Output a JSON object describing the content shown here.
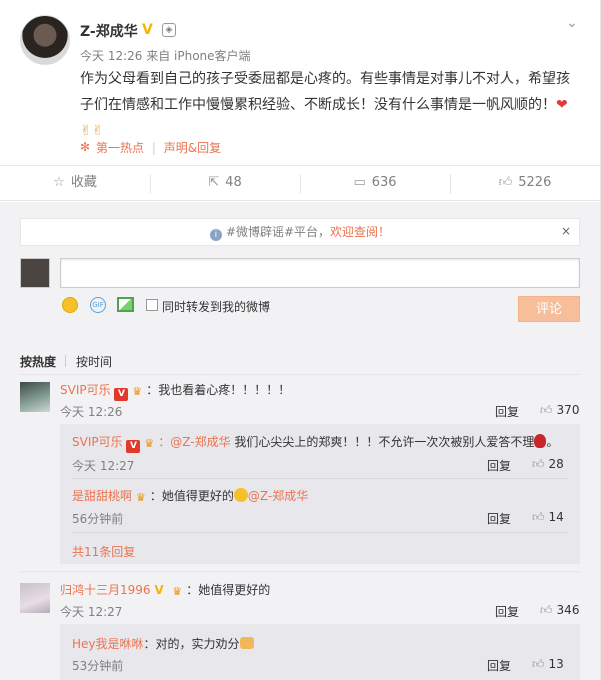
{
  "post": {
    "username": "Z-郑成华",
    "meta": "今天 12:26 来自 iPhone客户端",
    "text_line1": "作为父母看到自己的孩子受委屈都是心疼的。有些事情是对事儿不对人，希望孩",
    "text_line2": "子们在情感和工作中慢慢累积经验、不断成长！没有什么事情是一帆风顺的！",
    "text_line3": "✌✌",
    "hot_label": "第一热点",
    "statement_label": "声明&回复"
  },
  "actions": {
    "collect": "收藏",
    "forward_count": "48",
    "comment_count": "636",
    "like_count": "5226"
  },
  "notice": {
    "prefix": "#微博辟谣#平台，",
    "link": "欢迎查阅！",
    "close": "×"
  },
  "composer": {
    "forward_label": "同时转发到我的微博",
    "submit": "评论",
    "gif": "GIF"
  },
  "sort": {
    "hot": "按热度",
    "time": "按时间"
  },
  "comments": [
    {
      "name": "SVIP可乐",
      "text": "：我也看着心疼！！！！！",
      "time": "今天 12:26",
      "reply": "回复",
      "likes": "370",
      "replies": [
        {
          "name": "SVIP可乐",
          "mention": "：@Z-郑成华",
          "text": " 我们心尖尖上的郑爽！！！不允许一次次被别人爱答不理",
          "time": "今天 12:27",
          "reply": "回复",
          "likes": "28"
        },
        {
          "name": "是甜甜桃啊",
          "text_pre": "：她值得更好的",
          "mention": "@Z-郑成华",
          "time": "56分钟前",
          "reply": "回复",
          "likes": "14"
        }
      ],
      "more": "共11条回复"
    },
    {
      "name": "归鸿十三月1996",
      "text": "：她值得更好的",
      "time": "今天 12:27",
      "reply": "回复",
      "likes": "346",
      "replies": [
        {
          "name": "Hey我是咻咻",
          "text": "：对的，实力劝分",
          "time": "53分钟前",
          "reply": "回复",
          "likes": "13"
        }
      ]
    }
  ],
  "colors": {
    "accent": "#eb7350",
    "vip": "#e03a2a",
    "verified": "#f7b500"
  }
}
